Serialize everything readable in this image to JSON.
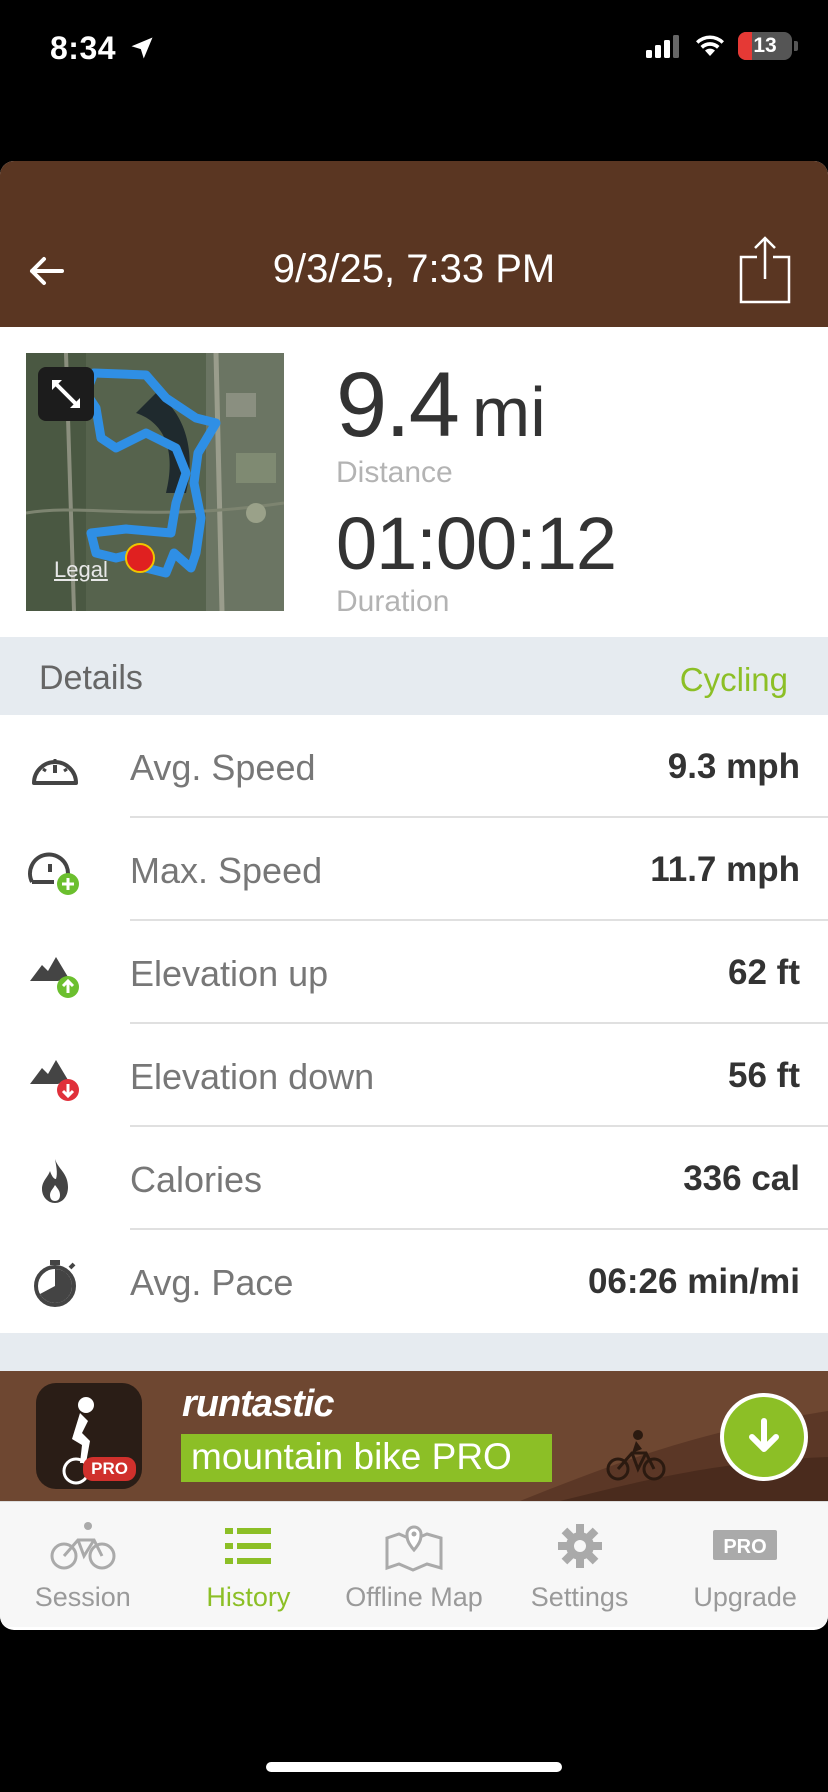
{
  "status_bar": {
    "time": "8:34",
    "battery": "13",
    "icons": [
      "location-arrow-icon",
      "signal-icon",
      "wifi-icon",
      "battery-icon"
    ]
  },
  "header": {
    "title": "9/3/25, 7:33 PM",
    "back_icon": "back-arrow-icon",
    "share_icon": "share-icon"
  },
  "summary": {
    "map_legal": "Legal",
    "distance_value": "9.4",
    "distance_unit": "mi",
    "distance_label": "Distance",
    "duration_value": "01:00:12",
    "duration_label": "Duration"
  },
  "details": {
    "title": "Details",
    "sport": "Cycling",
    "rows": [
      {
        "icon": "speedometer-icon",
        "label": "Avg. Speed",
        "value": "9.3 mph"
      },
      {
        "icon": "max-speed-icon",
        "label": "Max. Speed",
        "value": "11.7 mph"
      },
      {
        "icon": "elevation-up-icon",
        "label": "Elevation up",
        "value": "62 ft"
      },
      {
        "icon": "elevation-down-icon",
        "label": "Elevation down",
        "value": "56 ft"
      },
      {
        "icon": "flame-icon",
        "label": "Calories",
        "value": "336 cal"
      },
      {
        "icon": "stopwatch-icon",
        "label": "Avg. Pace",
        "value": "06:26 min/mi"
      }
    ]
  },
  "banner": {
    "brand": "runtastic",
    "product": "mountain bike PRO",
    "badge": "PRO"
  },
  "tabs": [
    {
      "label": "Session",
      "icon": "bicycle-icon",
      "active": false
    },
    {
      "label": "History",
      "icon": "list-icon",
      "active": true
    },
    {
      "label": "Offline Map",
      "icon": "map-pin-icon",
      "active": false
    },
    {
      "label": "Settings",
      "icon": "gear-icon",
      "active": false
    },
    {
      "label": "Upgrade",
      "icon": "pro-icon",
      "active": false
    }
  ],
  "colors": {
    "header_bg": "#5a3622",
    "accent": "#8cbf26",
    "details_bg": "#e6ebf0",
    "route": "#2f8fe5"
  }
}
